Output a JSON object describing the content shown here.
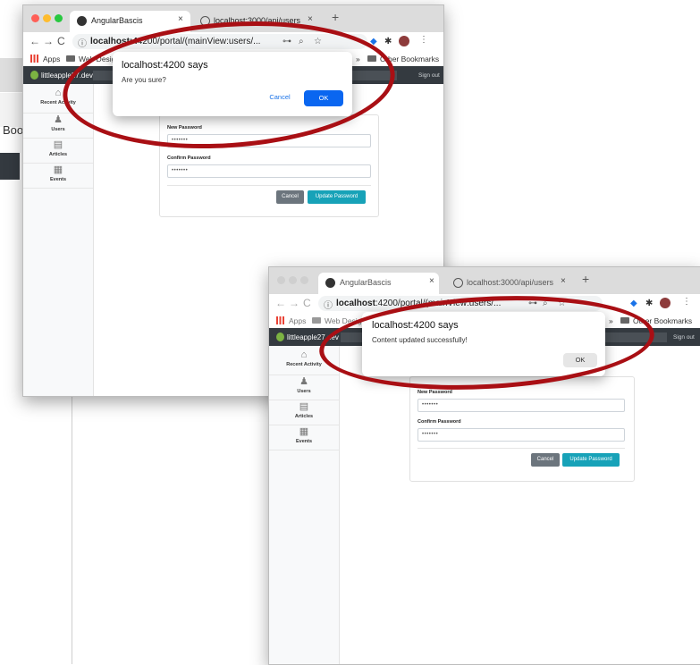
{
  "background_window": {
    "bookmarks_partial": "Boo"
  },
  "window1": {
    "tabs": [
      {
        "label": "AngularBascis",
        "close": "×"
      },
      {
        "label": "localhost:3000/api/users",
        "close": "×"
      }
    ],
    "new_tab": "+",
    "url_host": "localhost:4",
    "url_rest": "4200/portal/(mainView:users/...",
    "bookmarks": {
      "apps": "Apps",
      "folder": "Web Design",
      "other": "Other Bookmarks",
      "more": "»"
    },
    "navbar": {
      "brand": "littleapple27.dev",
      "sign_out": "Sign out"
    },
    "sidebar": [
      {
        "label": "Recent Activity",
        "icon": "home-icon"
      },
      {
        "label": "Users",
        "icon": "user-icon"
      },
      {
        "label": "Articles",
        "icon": "articles-icon"
      },
      {
        "label": "Events",
        "icon": "calendar-icon"
      }
    ],
    "form": {
      "new_password_label": "New Password",
      "new_password_value": "•••••••",
      "confirm_password_label": "Confirm Password",
      "confirm_password_value": "•••••••",
      "cancel": "Cancel",
      "update": "Update Password"
    },
    "dialog": {
      "title": "localhost:4200 says",
      "message": "Are you sure?",
      "cancel": "Cancel",
      "ok": "OK"
    }
  },
  "window2": {
    "tabs": [
      {
        "label": "AngularBascis",
        "close": "×"
      },
      {
        "label": "localhost:3000/api/users",
        "close": "×"
      }
    ],
    "new_tab": "+",
    "url_host": "localhost",
    "url_rest": ":4200/portal/(mainView:users/...",
    "bookmarks": {
      "apps": "Apps",
      "folder": "Web Design",
      "other": "Other Bookmarks",
      "more": "»"
    },
    "navbar": {
      "brand": "littleapple27.dev",
      "sign_out": "Sign out"
    },
    "sidebar": [
      {
        "label": "Recent Activity",
        "icon": "home-icon"
      },
      {
        "label": "Users",
        "icon": "user-icon"
      },
      {
        "label": "Articles",
        "icon": "articles-icon"
      },
      {
        "label": "Events",
        "icon": "calendar-icon"
      }
    ],
    "form": {
      "new_password_label": "New Password",
      "new_password_value": "•••••••",
      "confirm_password_label": "Confirm Password",
      "confirm_password_value": "•••••••",
      "cancel": "Cancel",
      "update": "Update Password"
    },
    "dialog": {
      "title": "localhost:4200 says",
      "message": "Content updated successfully!",
      "ok": "OK"
    }
  },
  "colors": {
    "annotation_ring": "#a90f14",
    "primary_button": "#0a66f0",
    "teal_button": "#17a2b8",
    "gray_button": "#6c757d",
    "navbar": "#343a40"
  }
}
